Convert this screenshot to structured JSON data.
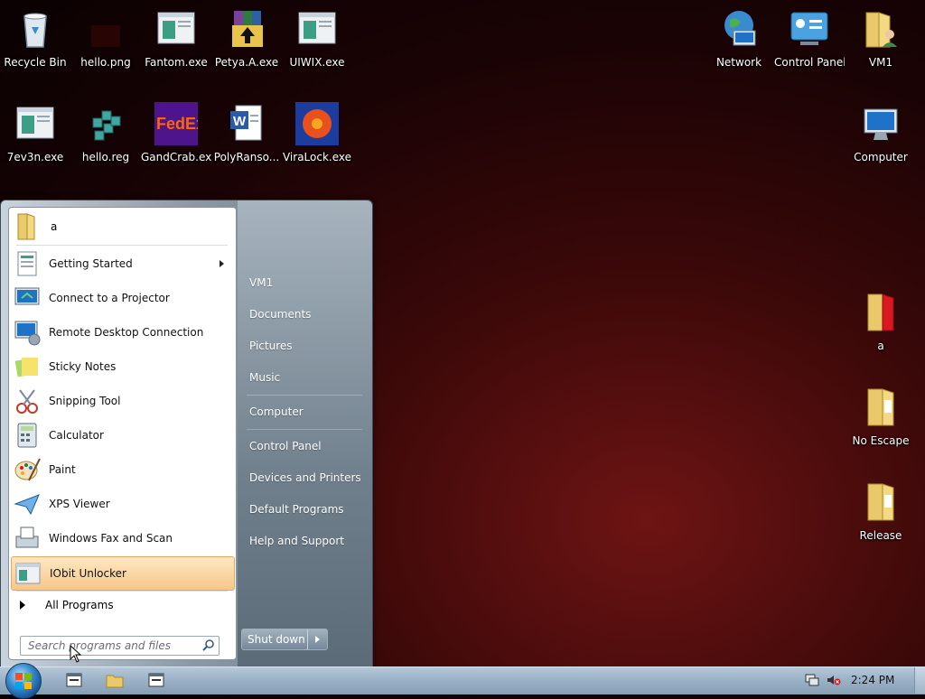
{
  "desktop": {
    "icons": [
      {
        "label": "Recycle Bin",
        "icon": "recycle-bin-icon"
      },
      {
        "label": "hello.png",
        "icon": "image-file-icon"
      },
      {
        "label": "Fantom.exe",
        "icon": "exe-window-icon"
      },
      {
        "label": "Petya.A.exe",
        "icon": "winrar-archive-icon"
      },
      {
        "label": "UIWIX.exe",
        "icon": "exe-window-icon"
      },
      {
        "label": "7ev3n.exe",
        "icon": "exe-window-icon"
      },
      {
        "label": "hello.reg",
        "icon": "registry-file-icon"
      },
      {
        "label": "GandCrab.exe",
        "icon": "fedex-logo-icon"
      },
      {
        "label": "PolyRanso...",
        "icon": "word-document-icon"
      },
      {
        "label": "ViraLock.exe",
        "icon": "orange-flower-icon"
      },
      {
        "label": "Network",
        "icon": "network-globe-icon"
      },
      {
        "label": "Control Panel",
        "icon": "control-panel-icon"
      },
      {
        "label": "VM1",
        "icon": "user-folder-icon"
      },
      {
        "label": "Computer",
        "icon": "computer-icon"
      },
      {
        "label": "a",
        "icon": "folder-icon"
      },
      {
        "label": "No Escape",
        "icon": "folder-icon"
      },
      {
        "label": "Release",
        "icon": "folder-icon"
      }
    ]
  },
  "start_menu": {
    "pinned": {
      "label": "a",
      "icon": "folder-icon"
    },
    "programs": [
      {
        "label": "Getting Started",
        "icon": "getting-started-icon",
        "has_submenu": true
      },
      {
        "label": "Connect to a Projector",
        "icon": "projector-icon"
      },
      {
        "label": "Remote Desktop Connection",
        "icon": "remote-desktop-icon"
      },
      {
        "label": "Sticky Notes",
        "icon": "sticky-notes-icon"
      },
      {
        "label": "Snipping Tool",
        "icon": "scissors-icon"
      },
      {
        "label": "Calculator",
        "icon": "calculator-icon"
      },
      {
        "label": "Paint",
        "icon": "paint-palette-icon"
      },
      {
        "label": "XPS Viewer",
        "icon": "paper-plane-icon"
      },
      {
        "label": "Windows Fax and Scan",
        "icon": "fax-icon"
      },
      {
        "label": "IObit Unlocker",
        "icon": "exe-window-icon",
        "highlighted": true
      }
    ],
    "all_programs": "All Programs",
    "search_placeholder": "Search programs and files",
    "right_links": [
      "VM1",
      "Documents",
      "Pictures",
      "Music",
      "Computer",
      "Control Panel",
      "Devices and Printers",
      "Default Programs",
      "Help and Support"
    ],
    "shutdown_label": "Shut down"
  },
  "taskbar": {
    "clock": "2:24 PM"
  }
}
